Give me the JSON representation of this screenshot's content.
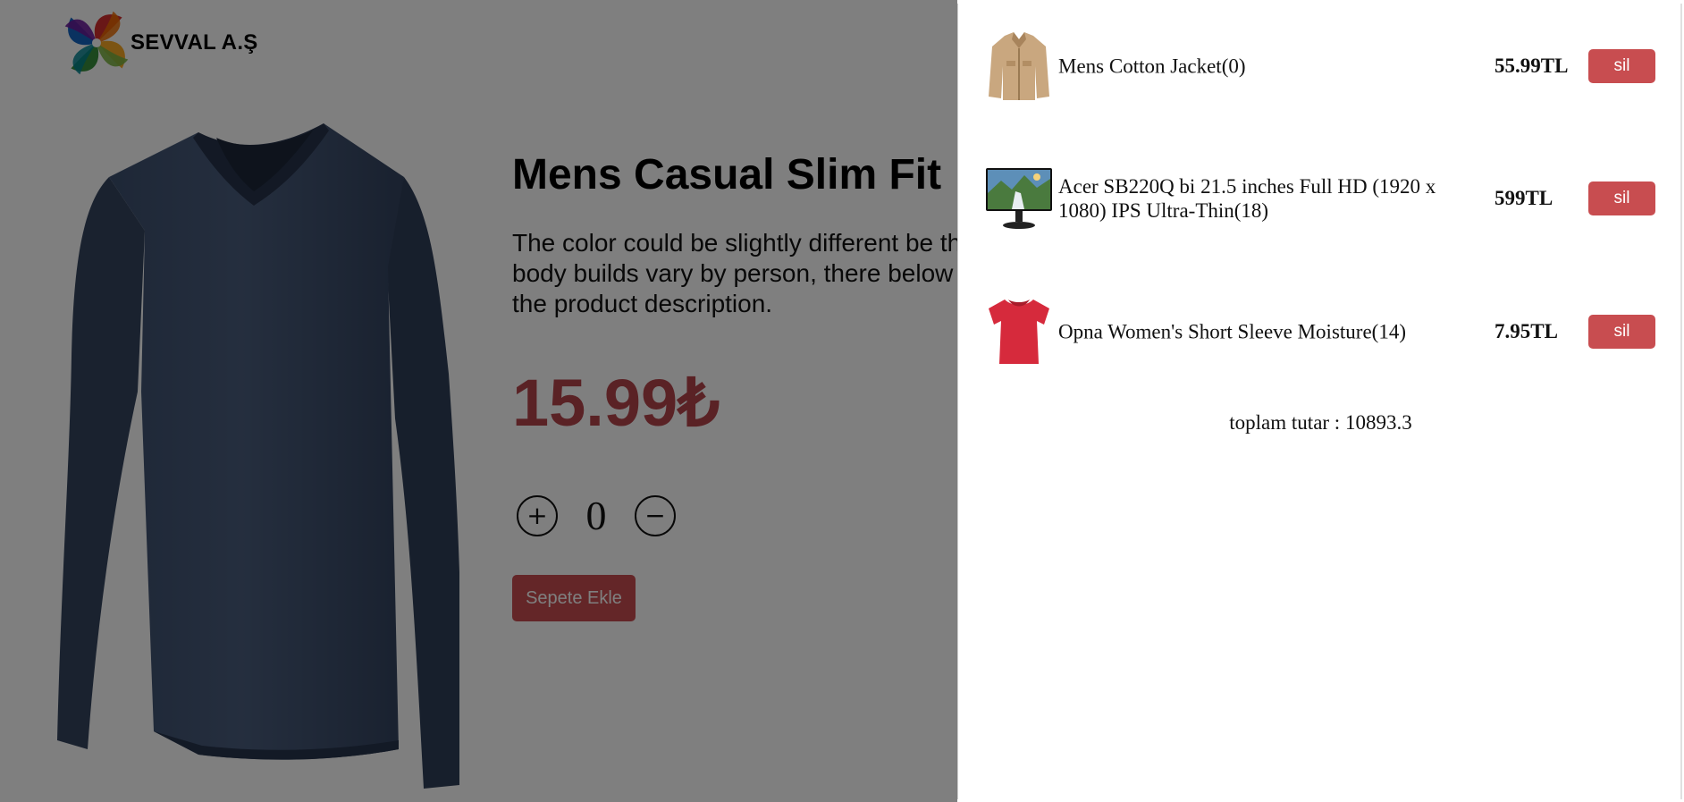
{
  "header": {
    "brand": "SEVVAL A.Ş"
  },
  "product": {
    "title": "Mens Casual Slim Fit",
    "description": "The color could be slightly different between on the screen and in practice. / Please note that body builds vary by person, therefore, detailed size information should be reviewed below on the product description.",
    "description_visible": "The color could be slightly different be that body builds vary by person, there below on the product description.",
    "price": "15.99₺",
    "quantity": "0",
    "plus_label": "+",
    "minus_label": "−",
    "add_to_cart_label": "Sepete Ekle"
  },
  "cart": {
    "items": [
      {
        "name": "Mens Cotton Jacket(0)",
        "price": "55.99TL",
        "delete_label": "sil",
        "icon": "jacket-thumbnail"
      },
      {
        "name": "Acer SB220Q bi 21.5 inches Full HD (1920 x 1080) IPS Ultra-Thin(18)",
        "price": "599TL",
        "delete_label": "sil",
        "icon": "monitor-thumbnail"
      },
      {
        "name": "Opna Women's Short Sleeve Moisture(14)",
        "price": "7.95TL",
        "delete_label": "sil",
        "icon": "red-shirt-thumbnail"
      }
    ],
    "total_label": "toplam tutar : ",
    "total_value": "10893.3"
  },
  "colors": {
    "accent": "#c84d50",
    "overlay": "rgba(0,0,0,0.5)"
  }
}
